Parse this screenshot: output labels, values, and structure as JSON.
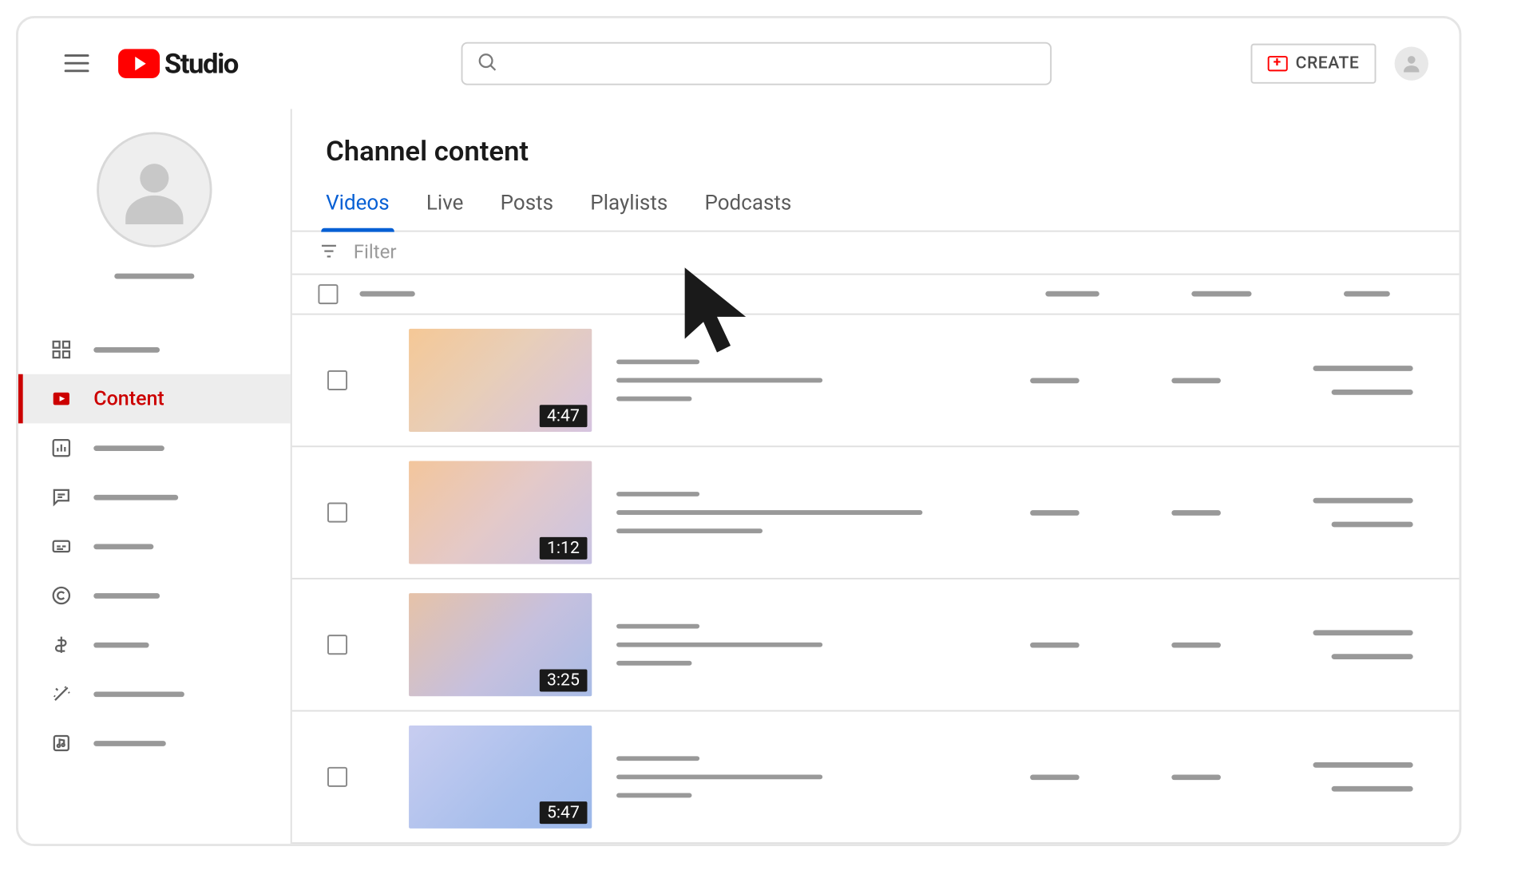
{
  "header": {
    "logo_text": "Studio",
    "search_placeholder": "",
    "create_label": "CREATE"
  },
  "sidebar": {
    "items": [
      {
        "id": "dashboard",
        "active": false
      },
      {
        "id": "content",
        "label": "Content",
        "active": true
      },
      {
        "id": "analytics",
        "active": false
      },
      {
        "id": "comments",
        "active": false
      },
      {
        "id": "subtitles",
        "active": false
      },
      {
        "id": "copyright",
        "active": false
      },
      {
        "id": "earn",
        "active": false
      },
      {
        "id": "customization",
        "active": false
      },
      {
        "id": "audio",
        "active": false
      }
    ]
  },
  "main": {
    "page_title": "Channel content",
    "tabs": [
      {
        "label": "Videos",
        "active": true
      },
      {
        "label": "Live",
        "active": false
      },
      {
        "label": "Posts",
        "active": false
      },
      {
        "label": "Playlists",
        "active": false
      },
      {
        "label": "Podcasts",
        "active": false
      }
    ],
    "filter_placeholder": "Filter",
    "videos": [
      {
        "duration": "4:47",
        "grad": "g1"
      },
      {
        "duration": "1:12",
        "grad": "g2"
      },
      {
        "duration": "3:25",
        "grad": "g3"
      },
      {
        "duration": "5:47",
        "grad": "g4"
      }
    ]
  }
}
